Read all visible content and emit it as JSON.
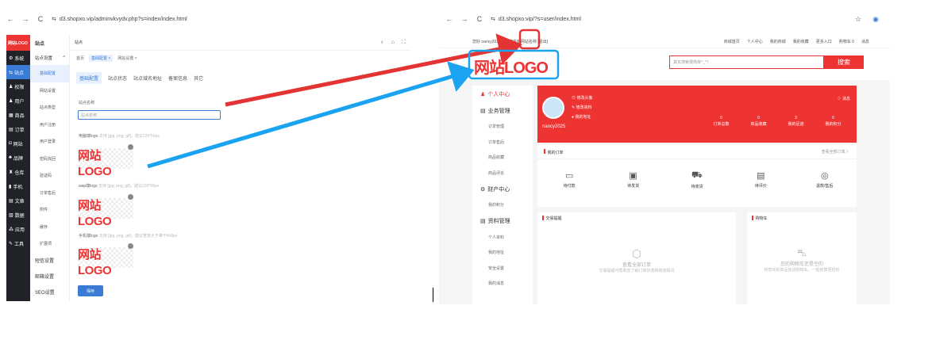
{
  "left": {
    "url": "d3.shopxo.vip/adminvkvydv.php?s=index/index.html",
    "brand": "网站LOGO",
    "sidebar": [
      "系统",
      "站点",
      "权限",
      "用户",
      "商品",
      "订单",
      "网站",
      "品牌",
      "仓库",
      "手机",
      "文章",
      "数据",
      "应用",
      "工具"
    ],
    "submenu_title": "站点",
    "group": "站点设置",
    "subitems": [
      "基础配置",
      "网站设置",
      "站点类型",
      "用户注册",
      "用户登录",
      "密码找回",
      "验证码",
      "订单售后",
      "附件",
      "缓存",
      "扩展项"
    ],
    "groups2": [
      "短信设置",
      "邮箱设置",
      "SEO设置"
    ],
    "page_title": "站点",
    "tabs": [
      "首页",
      "基础配置",
      "网站设置"
    ],
    "config_tabs": [
      "基础配置",
      "站点状态",
      "站点域名地址",
      "备案信息",
      "其它"
    ],
    "site_name_label": "站点名称",
    "site_name_placeholder": "站点名称",
    "pc_logo_label": "电脑端logo",
    "pc_logo_hint": "支持 [jpg, png, gif]，建议220*66px",
    "wap_logo_label": "wap端logo",
    "wap_logo_hint": "支持 [jpg, png, gif]，建议220*66px",
    "app_logo_label": "手机端logo",
    "app_logo_hint": "支持 [jpg, png, gif]，建议宽度大于等于400px",
    "logo_text": "网站LOGO",
    "save": "保存"
  },
  "right": {
    "url": "d3.shopxo.vip/?s=user/index.html",
    "greeting": "您好 nancy2025，欢迎来到",
    "site_name": "网站名称",
    "logout": "[退出]",
    "topnav": [
      "商城首页",
      "个人中心",
      "我的商城",
      "我的收藏",
      "更多入口",
      "购物车 0",
      "消息"
    ],
    "logo": "网站LOGO",
    "search_placeholder": "其实搜索很简单^_^！",
    "search_btn": "搜索",
    "side": {
      "g1": "个人中心",
      "g2": "业务管理",
      "g2items": [
        "订单管理",
        "订单售后",
        "商品收藏",
        "商品评论"
      ],
      "g3": "财产中心",
      "g3items": [
        "我的积分"
      ],
      "g4": "资料管理",
      "g4items": [
        "个人资料",
        "我的地址",
        "安全设置",
        "我的消息"
      ]
    },
    "card": {
      "links": [
        "修改头像",
        "修改资料",
        "我的地址"
      ],
      "username": "nancy2025",
      "msg": "消息",
      "stats": [
        {
          "n": "0",
          "label": "订单总数"
        },
        {
          "n": "0",
          "label": "商品收藏"
        },
        {
          "n": "3",
          "label": "我的足迹"
        },
        {
          "n": "0",
          "label": "我的积分"
        }
      ]
    },
    "orders_title": "我的订单",
    "orders_all": "查看全部订单 〉",
    "order_states": [
      "待付款",
      "待发货",
      "待收货",
      "待评价",
      "退款/售后"
    ],
    "trade_title": "交易提醒",
    "trade_empty": "查看全部订单",
    "trade_empty_sub": "交易提醒可帮助您了解订单状态和物流情况",
    "cart_title": "购物车",
    "cart_empty": "您的购物车还是空的",
    "cart_empty_sub": "将您买的商品放进购物车，一起结算更轻松"
  },
  "colors": {
    "red": "#e33333",
    "blue": "#1aa3f0",
    "admin_blue": "#3a7bd5"
  }
}
